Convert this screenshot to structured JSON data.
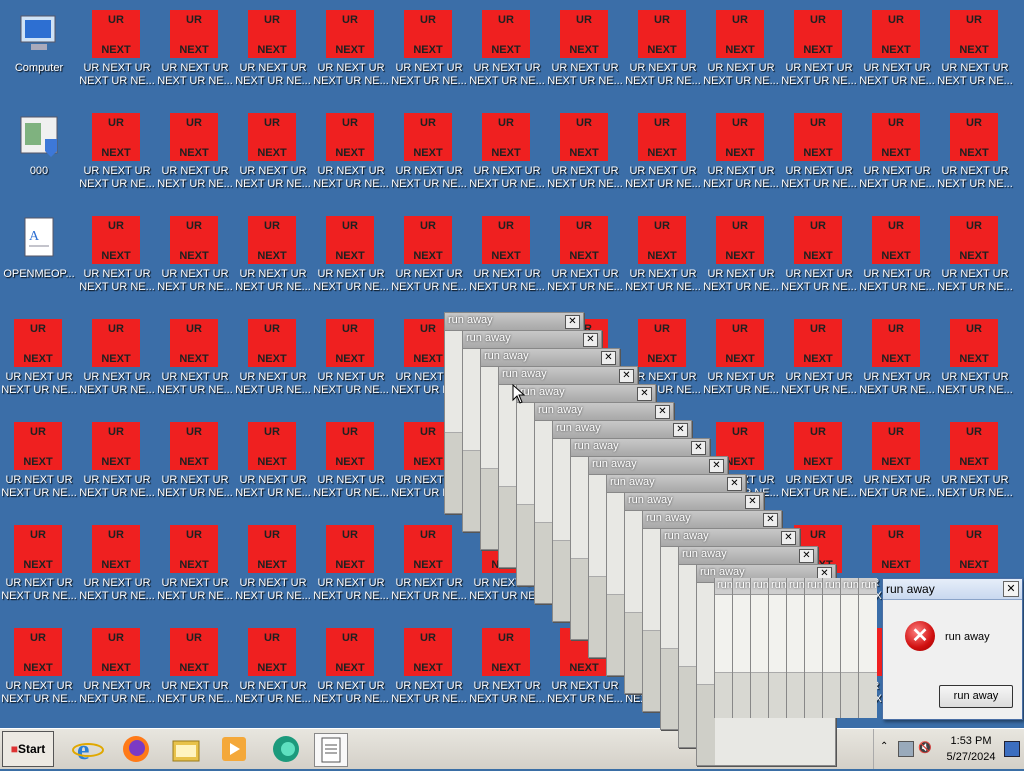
{
  "desktop": {
    "system_icons": [
      {
        "label": "Computer",
        "icon": "computer-icon"
      },
      {
        "label": "000",
        "icon": "shield-app-icon"
      },
      {
        "label": "OPENMEOP...",
        "icon": "document-icon"
      }
    ],
    "ur_tile": {
      "top": "UR",
      "bottom": "NEXT"
    },
    "ur_label_line1": "UR NEXT UR",
    "ur_label_line2": "NEXT UR NE..."
  },
  "popup_windows": {
    "title": "run away",
    "close": "✕"
  },
  "dialog": {
    "title": "run away",
    "message": "run away",
    "button": "run away",
    "close": "✕",
    "icon": "error-icon",
    "strip_title": "run"
  },
  "taskbar": {
    "start_label": "Start",
    "pinned": [
      "internet-explorer-icon",
      "firefox-icon",
      "file-explorer-icon",
      "media-player-icon",
      "chat-app-icon",
      "notepad-icon"
    ],
    "time": "1:53 PM",
    "date": "5/27/2024",
    "tray_icons": [
      "show-hidden-icons-chevron",
      "network-icon",
      "volume-muted-icon",
      "show-desktop-icon"
    ]
  },
  "colors": {
    "desktop": "#3b6ea8",
    "tile": "#ef2020",
    "taskbar": "#d4d0c8"
  }
}
